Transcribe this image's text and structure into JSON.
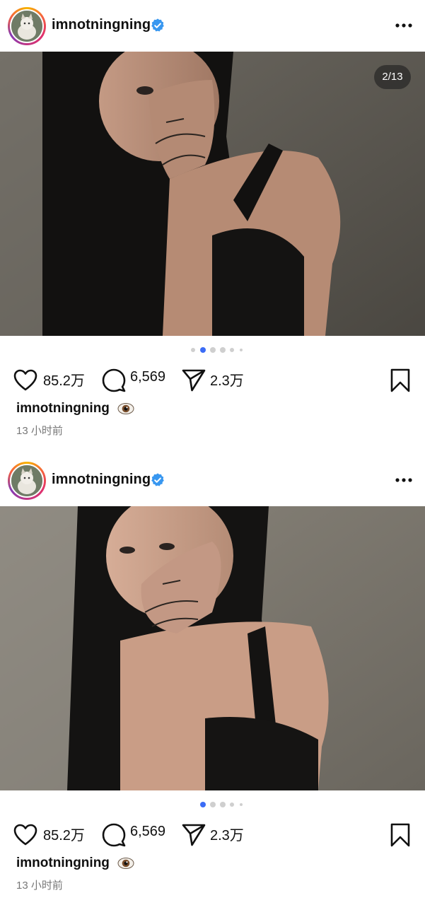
{
  "posts": [
    {
      "username": "imnotningning",
      "counter": "2/13",
      "likes": "85.2万",
      "comments": "6,569",
      "shares": "2.3万",
      "caption_user": "imnotningning",
      "caption_emoji_icon": "eye-emoji",
      "time": "13 小时前",
      "dots_active": 1
    },
    {
      "username": "imnotningning",
      "likes": "85.2万",
      "comments": "6,569",
      "shares": "2.3万",
      "caption_user": "imnotningning",
      "caption_emoji_icon": "eye-emoji",
      "time": "13 小时前",
      "dots_active": 0
    }
  ],
  "colors": {
    "verified": "#3897f0",
    "dot_active": "#3b6cf6",
    "dot_inactive": "#cfcfcf"
  }
}
